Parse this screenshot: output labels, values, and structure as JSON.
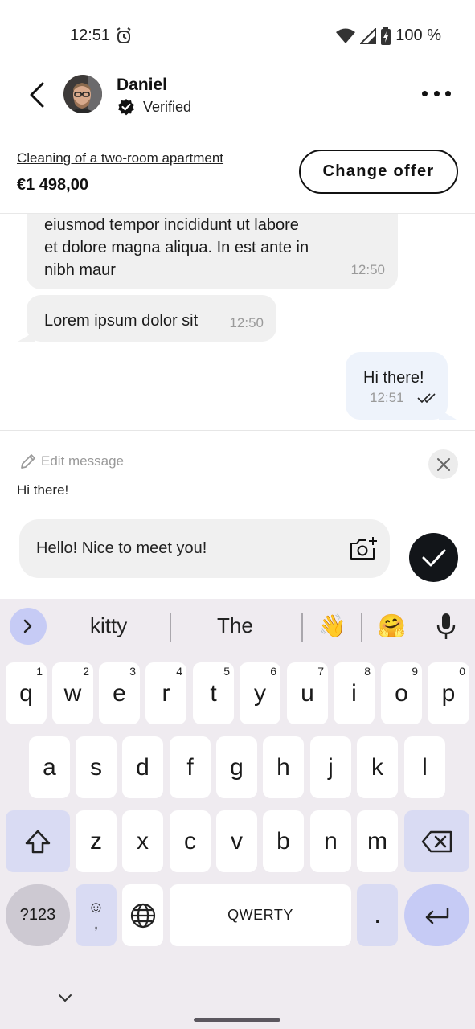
{
  "status_bar": {
    "time": "12:51",
    "battery": "100 %"
  },
  "header": {
    "contact_name": "Daniel",
    "verified_label": "Verified"
  },
  "offer": {
    "title": "Cleaning of a two-room apartment",
    "price": "€1 498,00",
    "change_label": "Change offer"
  },
  "messages": [
    {
      "direction": "incoming",
      "lines": [
        "eiusmod tempor incididunt ut labore",
        "et dolore magna aliqua. In est ante in",
        "nibh maur"
      ],
      "time": "12:50"
    },
    {
      "direction": "incoming",
      "text": "Lorem ipsum dolor sit",
      "time": "12:50"
    },
    {
      "direction": "outgoing",
      "text": "Hi there!",
      "time": "12:51",
      "status": "read"
    }
  ],
  "edit": {
    "label": "Edit message",
    "original_text": "Hi there!",
    "input_value": "Hello! Nice to meet you!"
  },
  "keyboard": {
    "suggestions": [
      "kitty",
      "The"
    ],
    "emoji_suggestions": [
      "👋",
      "🤗"
    ],
    "row1": [
      {
        "key": "q",
        "num": "1"
      },
      {
        "key": "w",
        "num": "2"
      },
      {
        "key": "e",
        "num": "3"
      },
      {
        "key": "r",
        "num": "4"
      },
      {
        "key": "t",
        "num": "5"
      },
      {
        "key": "y",
        "num": "6"
      },
      {
        "key": "u",
        "num": "7"
      },
      {
        "key": "i",
        "num": "8"
      },
      {
        "key": "o",
        "num": "9"
      },
      {
        "key": "p",
        "num": "0"
      }
    ],
    "row2": [
      "a",
      "s",
      "d",
      "f",
      "g",
      "h",
      "j",
      "k",
      "l"
    ],
    "row3": [
      "z",
      "x",
      "c",
      "v",
      "b",
      "n",
      "m"
    ],
    "symbols_label": "?123",
    "emoji_key_top": "☺",
    "emoji_key_bottom": ",",
    "space_label": "QWERTY",
    "period_label": "."
  }
}
